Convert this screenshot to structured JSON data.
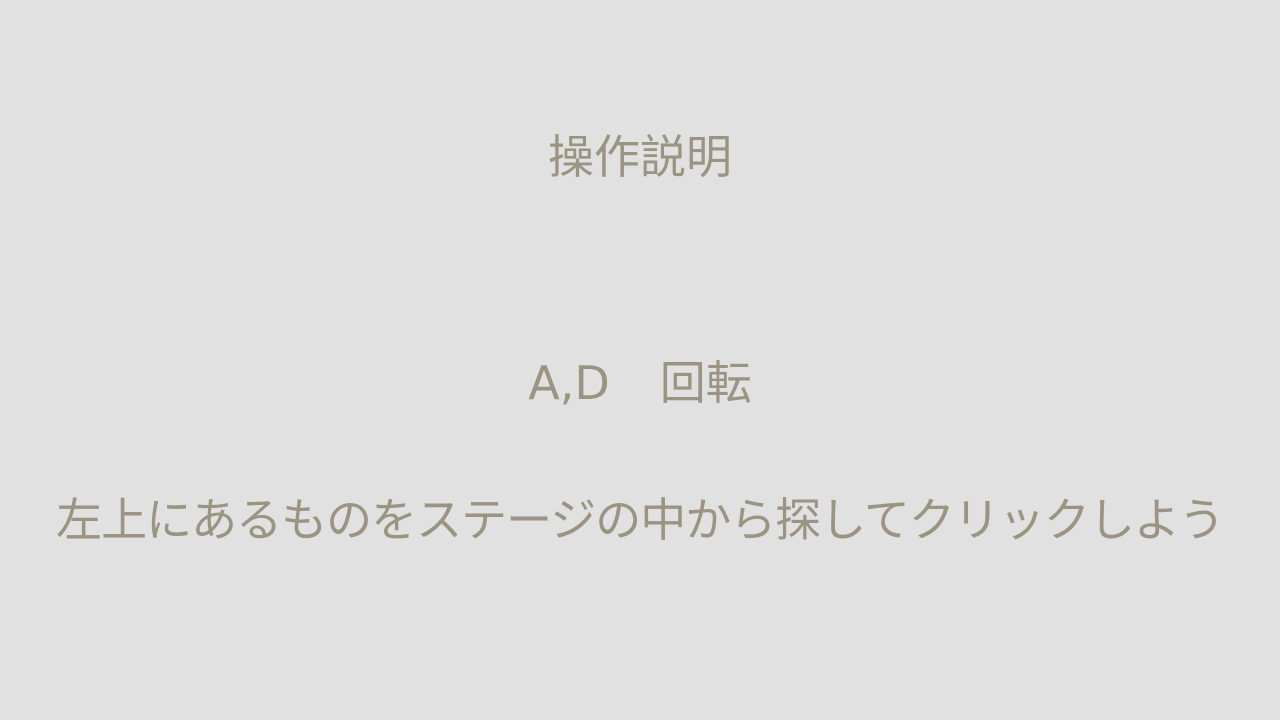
{
  "screen": {
    "title": "操作説明",
    "controls": [
      {
        "key": "A,D",
        "action": "回転"
      }
    ],
    "instruction": "左上にあるものをステージの中から探してクリックしよう"
  },
  "colors": {
    "background": "#e1e1e1",
    "text": "#9b9482"
  }
}
